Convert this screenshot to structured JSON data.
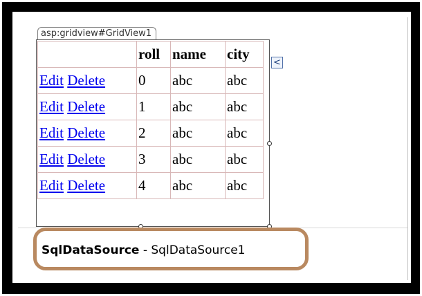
{
  "tag": "asp:gridview#GridView1",
  "smart_tag_glyph": "<",
  "grid": {
    "columns": [
      "",
      "roll",
      "name",
      "city"
    ],
    "rows": [
      {
        "edit": "Edit",
        "delete": "Delete",
        "roll": "0",
        "name": "abc",
        "city": "abc"
      },
      {
        "edit": "Edit",
        "delete": "Delete",
        "roll": "1",
        "name": "abc",
        "city": "abc"
      },
      {
        "edit": "Edit",
        "delete": "Delete",
        "roll": "2",
        "name": "abc",
        "city": "abc"
      },
      {
        "edit": "Edit",
        "delete": "Delete",
        "roll": "3",
        "name": "abc",
        "city": "abc"
      },
      {
        "edit": "Edit",
        "delete": "Delete",
        "roll": "4",
        "name": "abc",
        "city": "abc"
      }
    ]
  },
  "datasource": {
    "type": "SqlDataSource",
    "separator": " - ",
    "id": "SqlDataSource1"
  },
  "colors": {
    "link": "#0000ee",
    "highlight": "#b98960"
  }
}
